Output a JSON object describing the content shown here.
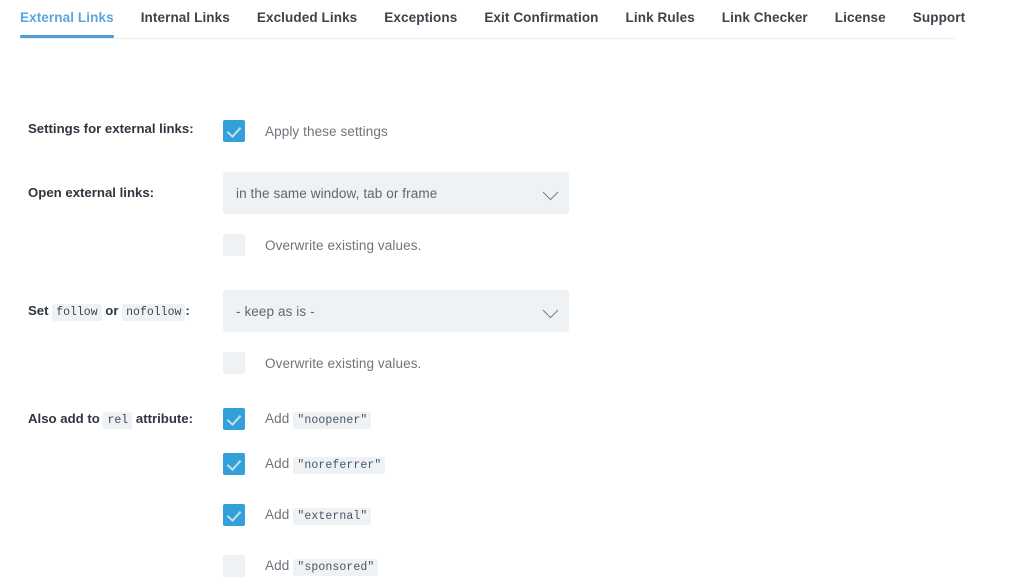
{
  "tabs": [
    {
      "label": "External Links",
      "active": true
    },
    {
      "label": "Internal Links",
      "active": false
    },
    {
      "label": "Excluded Links",
      "active": false
    },
    {
      "label": "Exceptions",
      "active": false
    },
    {
      "label": "Exit Confirmation",
      "active": false
    },
    {
      "label": "Link Rules",
      "active": false
    },
    {
      "label": "Link Checker",
      "active": false
    },
    {
      "label": "License",
      "active": false
    },
    {
      "label": "Support",
      "active": false
    }
  ],
  "colors": {
    "accent": "#33a0da",
    "active_tab_text": "#58a8dd",
    "tab_text": "#3c434a",
    "field_bg": "#eef2f5",
    "muted_text": "#6d747c"
  },
  "rows": {
    "settings_for_external_links": {
      "label": "Settings for external links:",
      "checkbox_label": "Apply these settings",
      "checked": true
    },
    "open_external_links": {
      "label": "Open external links:",
      "select_value": "in the same window, tab or frame",
      "chevron": "chevron-down-icon",
      "overwrite_label": "Overwrite existing values.",
      "overwrite_checked": false
    },
    "set_follow": {
      "label_prefix": "Set",
      "label_code_1": "follow",
      "label_mid": "or",
      "label_code_2": "nofollow",
      "label_suffix": ":",
      "select_value": "- keep as is -",
      "chevron": "chevron-down-icon",
      "overwrite_label": "Overwrite existing values.",
      "overwrite_checked": false
    },
    "rel_attribute": {
      "label_prefix": "Also add to",
      "label_code": "rel",
      "label_suffix": "attribute:",
      "options": [
        {
          "prefix": "Add",
          "code": "\"noopener\"",
          "checked": true
        },
        {
          "prefix": "Add",
          "code": "\"noreferrer\"",
          "checked": true
        },
        {
          "prefix": "Add",
          "code": "\"external\"",
          "checked": true
        },
        {
          "prefix": "Add",
          "code": "\"sponsored\"",
          "checked": false
        }
      ]
    }
  }
}
